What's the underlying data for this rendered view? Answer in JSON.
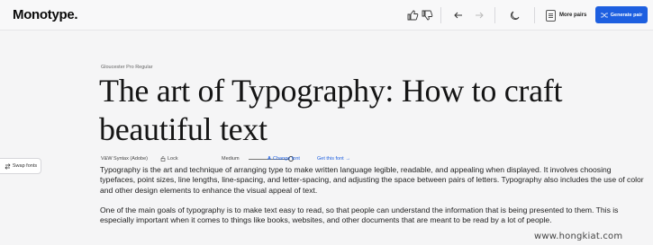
{
  "header": {
    "logo": "Monotype.",
    "more_pairs_label": "More pairs",
    "generate_label": "Generate pair"
  },
  "icons": {
    "thumbs_up": "thumbs-up-icon",
    "thumbs_down": "thumbs-down-icon",
    "back": "arrow-left-icon",
    "forward": "arrow-right-icon",
    "theme": "moon-icon",
    "shuffle": "shuffle-icon"
  },
  "sidebar": {
    "swap_label": "Swap fonts"
  },
  "main": {
    "font_name": "Gloucester Pro Regular",
    "headline": "The art of Typography: How to craft beautiful text",
    "body_font_name": "V&W Syntax (Adobe)",
    "lock_label": "Lock",
    "weight_label": "Medium",
    "change_font_label": "Change font",
    "get_font_label": "Get this font",
    "paragraphs": [
      "Typography is the art and technique of arranging type to make written language legible, readable, and appealing when displayed. It involves choosing typefaces, point sizes, line lengths, line-spacing, and letter-spacing, and adjusting the space between pairs of letters. Typography also includes the use of color and other design elements to enhance the visual appeal of text.",
      "One of the main goals of typography is to make text easy to read, so that people can understand the information that is being presented to them. This is especially important when it comes to things like books, websites, and other documents that are meant to be read by a lot of people."
    ]
  },
  "watermark": "www.hongkiat.com",
  "colors": {
    "accent": "#1d5fe0",
    "background": "#f5f5f6"
  }
}
